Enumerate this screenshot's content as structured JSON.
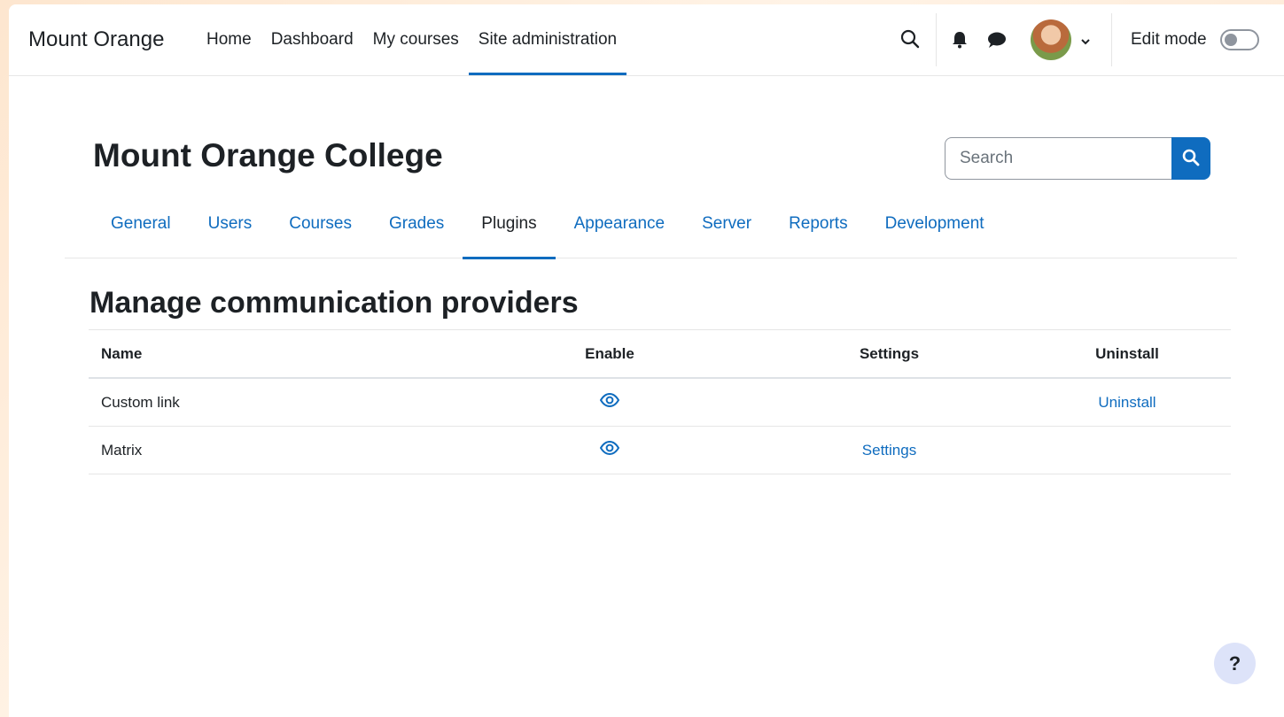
{
  "navbar": {
    "brand": "Mount Orange",
    "items": [
      {
        "label": "Home"
      },
      {
        "label": "Dashboard"
      },
      {
        "label": "My courses"
      },
      {
        "label": "Site administration",
        "active": true
      }
    ],
    "icons": [
      "search-icon",
      "bell-icon",
      "chat-icon",
      "chevron-down-icon"
    ],
    "edit_mode_label": "Edit mode",
    "edit_mode_on": false
  },
  "header": {
    "title": "Mount Orange College",
    "search_placeholder": "Search"
  },
  "admin_tabs": [
    {
      "label": "General"
    },
    {
      "label": "Users"
    },
    {
      "label": "Courses"
    },
    {
      "label": "Grades"
    },
    {
      "label": "Plugins",
      "active": true
    },
    {
      "label": "Appearance"
    },
    {
      "label": "Server"
    },
    {
      "label": "Reports"
    },
    {
      "label": "Development"
    }
  ],
  "section": {
    "title": "Manage communication providers",
    "columns": {
      "name": "Name",
      "enable": "Enable",
      "settings": "Settings",
      "uninstall": "Uninstall"
    },
    "rows": [
      {
        "name": "Custom link",
        "enable_icon": "eye-icon",
        "settings": "",
        "uninstall": "Uninstall"
      },
      {
        "name": "Matrix",
        "enable_icon": "eye-icon",
        "settings": "Settings",
        "uninstall": ""
      }
    ]
  },
  "help": {
    "label": "?"
  },
  "colors": {
    "accent": "#0f6cbf",
    "text": "#1d2125",
    "help_bg": "#dde3f9",
    "background": "#fde6cf"
  }
}
